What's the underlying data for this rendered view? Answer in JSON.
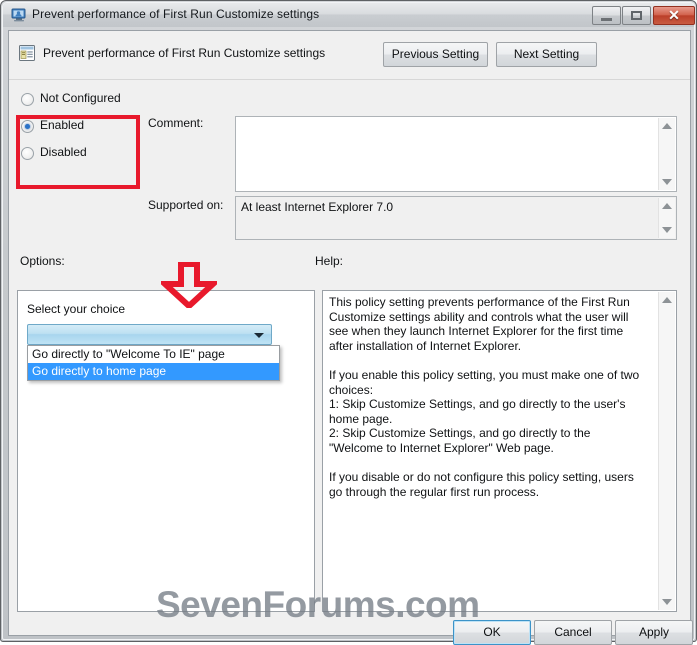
{
  "window": {
    "title": "Prevent performance of First Run Customize settings",
    "icon": "policy-window-icon",
    "minimize_label": "–",
    "maximize_label": "□",
    "close_label": "✕"
  },
  "header": {
    "policy_title": "Prevent performance of First Run Customize settings",
    "icon": "policy-setting-icon",
    "previous_setting": "Previous Setting",
    "next_setting": "Next Setting"
  },
  "state": {
    "options": [
      {
        "label": "Not Configured",
        "selected": false
      },
      {
        "label": "Enabled",
        "selected": true
      },
      {
        "label": "Disabled",
        "selected": false
      }
    ],
    "highlight_color": "#e8192c"
  },
  "comment": {
    "label": "Comment:",
    "value": "",
    "placeholder": ""
  },
  "supported": {
    "label": "Supported on:",
    "value": "At least Internet Explorer 7.0"
  },
  "options_panel": {
    "label": "Options:",
    "choice_label": "Select your choice",
    "combo_value": "",
    "combo_items": [
      {
        "label": "Go directly to \"Welcome To IE\" page",
        "selected": false
      },
      {
        "label": "Go directly to home page",
        "selected": true
      }
    ],
    "arrow_annotation_color": "#e8192c"
  },
  "help_panel": {
    "label": "Help:",
    "text": "This policy setting prevents performance of the First Run Customize settings ability and controls what the user will see when they launch Internet Explorer for the first time after installation of Internet Explorer.\n\nIf you enable this policy setting, you must make one of two choices:\n1: Skip Customize Settings, and go directly to the user's home page.\n2: Skip Customize Settings, and go directly to the \"Welcome to Internet Explorer\" Web page.\n\nIf you disable or do not configure this policy setting, users go through the regular first run process."
  },
  "footer": {
    "ok": "OK",
    "cancel": "Cancel",
    "apply": "Apply"
  },
  "watermark": {
    "text": "SevenForums.com"
  }
}
